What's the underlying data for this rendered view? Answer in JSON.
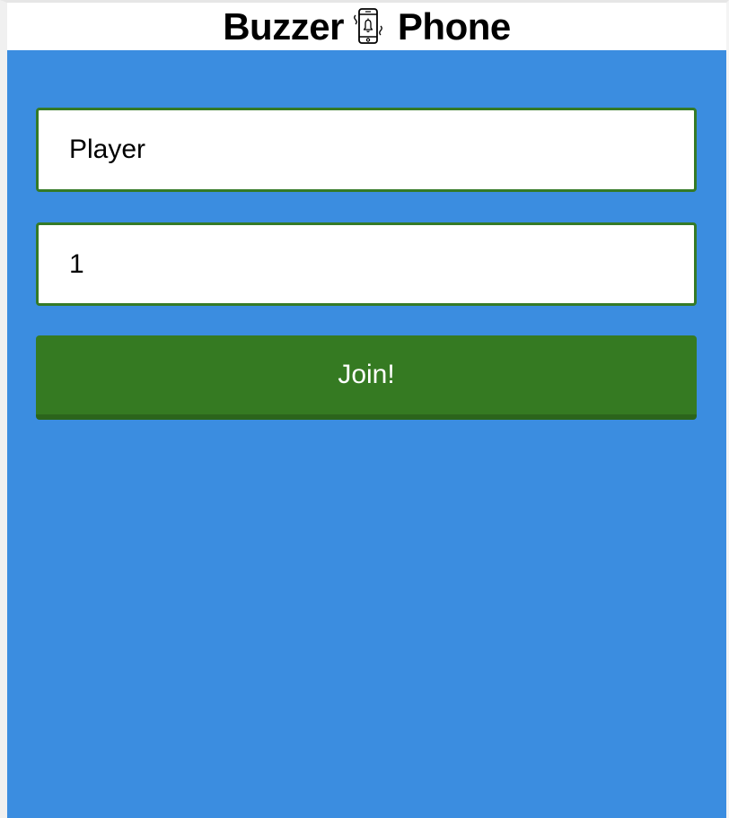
{
  "header": {
    "title_left": "Buzzer",
    "title_right": "Phone",
    "icon": "vibrating-phone-bell-icon"
  },
  "form": {
    "name_field": {
      "value": "Player"
    },
    "room_field": {
      "value": "1"
    },
    "join_button": {
      "label": "Join!"
    }
  },
  "colors": {
    "background": "#3b8de0",
    "field_border": "#357a27",
    "button": "#357a22",
    "button_text": "#ffffff"
  }
}
